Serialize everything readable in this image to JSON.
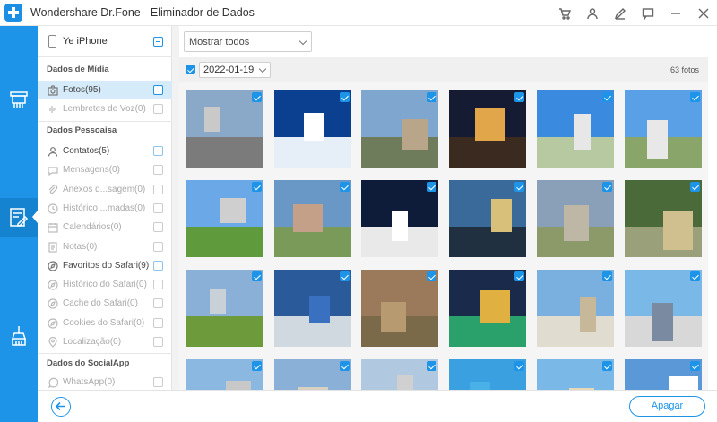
{
  "app": {
    "title": "Wondershare Dr.Fone - Eliminador de Dados"
  },
  "titlebar_icons": [
    "cart-icon",
    "user-icon",
    "edit-icon",
    "feedback-icon",
    "minimize-icon",
    "close-icon"
  ],
  "sidebar_icons": [
    "eraser-icon",
    "private-data-eraser-icon",
    "space-saver-icon"
  ],
  "device": {
    "name": "Ye iPhone"
  },
  "sections": {
    "media": "Dados de Mídia",
    "personal": "Dados Pessoaisa",
    "social": "Dados do SocialApp"
  },
  "categories": [
    {
      "label": "Fotos(95)",
      "icon": "photo-icon",
      "state": "partial"
    },
    {
      "label": "Lembretes de Voz(0)",
      "icon": "voice-icon",
      "state": "disabled"
    },
    {
      "label": "Contatos(5)",
      "icon": "contact-icon",
      "state": "enabled"
    },
    {
      "label": "Mensagens(0)",
      "icon": "message-icon",
      "state": "disabled"
    },
    {
      "label": "Anexos d...sagem(0)",
      "icon": "attachment-icon",
      "state": "disabled"
    },
    {
      "label": "Histórico ...madas(0)",
      "icon": "call-history-icon",
      "state": "disabled"
    },
    {
      "label": "Calendários(0)",
      "icon": "calendar-icon",
      "state": "disabled"
    },
    {
      "label": "Notas(0)",
      "icon": "notes-icon",
      "state": "disabled"
    },
    {
      "label": "Favoritos do Safari(9)",
      "icon": "safari-bookmark-icon",
      "state": "enabled"
    },
    {
      "label": "Histórico do Safari(0)",
      "icon": "safari-history-icon",
      "state": "disabled"
    },
    {
      "label": "Cache do Safari(0)",
      "icon": "safari-cache-icon",
      "state": "disabled"
    },
    {
      "label": "Cookies do Safari(0)",
      "icon": "safari-cookies-icon",
      "state": "disabled"
    },
    {
      "label": "Localização(0)",
      "icon": "location-icon",
      "state": "disabled"
    },
    {
      "label": "WhatsApp(0)",
      "icon": "whatsapp-icon",
      "state": "disabled"
    }
  ],
  "filter": {
    "selected": "Mostrar todos"
  },
  "date_group": {
    "date": "2022-01-19",
    "count": "63 fotos",
    "checked": true
  },
  "photos_visible": 24,
  "palette": {
    "accent": "#1d94e8",
    "sky": "#4a8fd0",
    "grass": "#6b9a3c",
    "night": "#1a1f3a",
    "concrete": "#d8d8d8"
  },
  "buttons": {
    "erase": "Apagar"
  }
}
